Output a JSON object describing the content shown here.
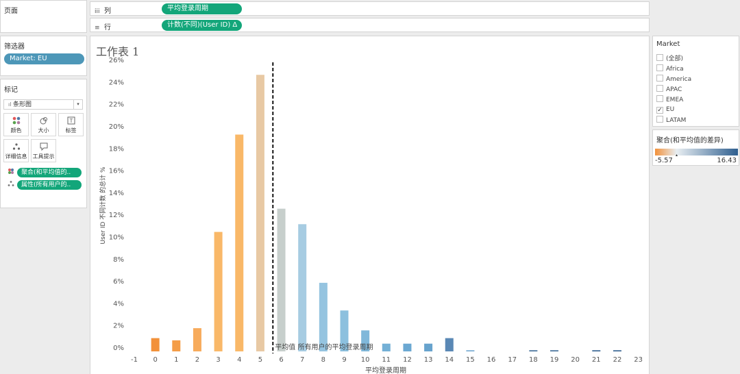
{
  "pages": {
    "title": "页面"
  },
  "columns_shelf": {
    "label": "列",
    "icon": "iii",
    "pill": "平均登录周期"
  },
  "rows_shelf": {
    "label": "行",
    "icon": "≡",
    "pill": "计数(不同)(User ID)  Δ"
  },
  "filters": {
    "title": "筛选器",
    "pill": "Market: EU"
  },
  "marks": {
    "title": "标记",
    "mark_type": "条形图",
    "buttons": [
      {
        "label": "颜色",
        "icon": "color-icon"
      },
      {
        "label": "大小",
        "icon": "size-icon"
      },
      {
        "label": "标签",
        "icon": "label-icon"
      },
      {
        "label": "详细信息",
        "icon": "detail-icon"
      },
      {
        "label": "工具提示",
        "icon": "tooltip-icon"
      }
    ],
    "pills": [
      {
        "label": "聚合(和平均值的..",
        "icon": "color-dots-icon"
      },
      {
        "label": "属性(所有用户的..",
        "icon": "detail-dots-icon"
      }
    ]
  },
  "sheet": {
    "title": "工作表 1"
  },
  "market_filter": {
    "title": "Market",
    "items": [
      {
        "label": "(全部)",
        "checked": false
      },
      {
        "label": "Africa",
        "checked": false
      },
      {
        "label": "America",
        "checked": false
      },
      {
        "label": "APAC",
        "checked": false
      },
      {
        "label": "EMEA",
        "checked": false
      },
      {
        "label": "EU",
        "checked": true
      },
      {
        "label": "LATAM",
        "checked": false
      }
    ]
  },
  "color_legend": {
    "title": "聚合(和平均值的差异)",
    "min_label": "-5.57",
    "max_label": "16.43",
    "colors": {
      "low": "#f2913a",
      "mid": "#e8eef2",
      "high": "#2f5f8f"
    }
  },
  "chart_data": {
    "type": "bar",
    "xlabel": "平均登录周期",
    "ylabel": "User ID 不同计数 的总计 %",
    "x_ticks": [
      -1,
      0,
      1,
      2,
      3,
      4,
      5,
      6,
      7,
      8,
      9,
      10,
      11,
      12,
      13,
      14,
      15,
      16,
      17,
      18,
      19,
      20,
      21,
      22,
      23
    ],
    "xlim": [
      -1,
      23
    ],
    "y_ticks": [
      "0%",
      "2%",
      "4%",
      "6%",
      "8%",
      "10%",
      "12%",
      "14%",
      "16%",
      "18%",
      "20%",
      "22%",
      "24%",
      "26%"
    ],
    "ylim": [
      0,
      26
    ],
    "x": [
      0,
      1,
      2,
      3,
      4,
      5,
      6,
      7,
      8,
      9,
      10,
      11,
      12,
      13,
      14,
      15,
      18,
      19,
      21,
      22
    ],
    "values": [
      1.2,
      1.0,
      2.1,
      10.8,
      19.6,
      25.0,
      12.9,
      11.5,
      6.2,
      3.7,
      1.9,
      0.7,
      0.7,
      0.7,
      1.2,
      0.1,
      0.1,
      0.1,
      0.1,
      0.1
    ],
    "colors": [
      "#f2913a",
      "#f49d48",
      "#f7ab5c",
      "#f9b868",
      "#f9b868",
      "#e8c9a4",
      "#c7cfcc",
      "#a7cce2",
      "#95c4e0",
      "#8cc0de",
      "#80b8da",
      "#74b0d6",
      "#6ba8d2",
      "#67a3cd",
      "#5a88b5",
      "#6fa6cf",
      "#3b6996",
      "#3b6996",
      "#2f5f8f",
      "#2f5f8f"
    ],
    "reference_line": {
      "x": 5.6,
      "label": "平均值 所有用户的平均登录周期"
    }
  }
}
